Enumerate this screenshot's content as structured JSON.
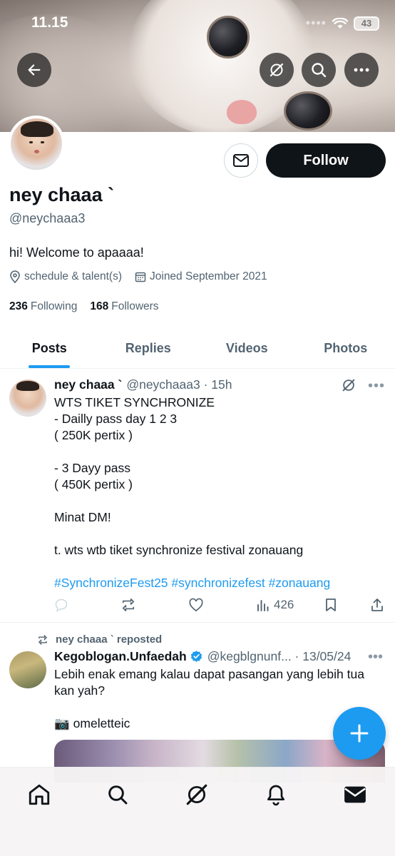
{
  "status_bar": {
    "time": "11.15",
    "battery": "43"
  },
  "profile": {
    "display_name": "ney chaaa `",
    "handle": "@neychaaa3",
    "bio": "hi! Welcome to apaaaa!",
    "location": "schedule & talent(s)",
    "joined": "Joined September 2021",
    "following_count": "236",
    "following_label": "Following",
    "followers_count": "168",
    "followers_label": "Followers",
    "follow_label": "Follow"
  },
  "tabs": [
    {
      "label": "Posts",
      "active": true
    },
    {
      "label": "Replies",
      "active": false
    },
    {
      "label": "Videos",
      "active": false
    },
    {
      "label": "Photos",
      "active": false
    }
  ],
  "posts": [
    {
      "name": "ney chaaa `",
      "handle": "@neychaaa3 · 15h",
      "lines": [
        "WTS TIKET SYNCHRONIZE",
        "- Dailly pass day 1 2 3",
        "( 250K pertix )",
        "",
        "- 3 Dayy pass",
        "( 450K pertix )",
        "",
        "Minat DM!",
        "",
        "t. wts wtb tiket synchronize festival zonauang",
        ""
      ],
      "hashtags": "#SynchronizeFest25 #synchronizefest #zonauang",
      "views": "426"
    },
    {
      "repost_label": "ney chaaa ` reposted",
      "name": "Kegoblogan.Unfaedah",
      "handle": "@kegblgnunf... · 13/05/24",
      "lines": [
        "Lebih enak emang kalau dapat pasangan yang lebih tua kan yah?",
        "",
        "📷 omeletteic"
      ]
    }
  ],
  "colors": {
    "accent": "#1d9bf0",
    "text": "#0f1419",
    "muted": "#536471"
  }
}
